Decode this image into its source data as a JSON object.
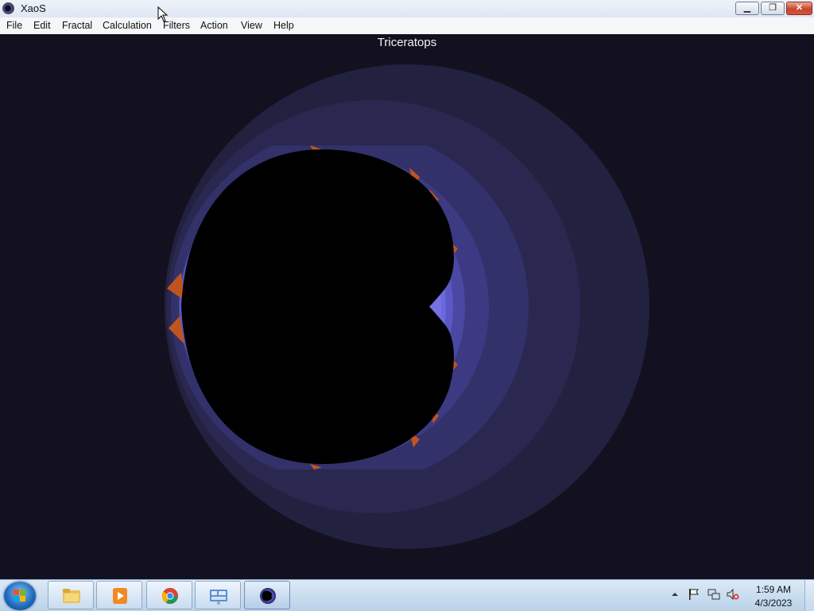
{
  "window": {
    "title": "XaoS",
    "icon": "xaos-app-icon",
    "controls": {
      "minimize": "minimize-icon",
      "maximize": "restore-icon",
      "close": "close-icon"
    }
  },
  "menu": {
    "items": [
      "File",
      "Edit",
      "Fractal",
      "Calculation",
      "Filters",
      "Action",
      "View",
      "Help"
    ]
  },
  "canvas": {
    "fractal_name": "Triceratops",
    "background_color": "#13111f",
    "palette": [
      "#25233f",
      "#2d2b55",
      "#39377a",
      "#4c4aa8",
      "#6d6bd8",
      "#000000",
      "#c25a24"
    ]
  },
  "taskbar": {
    "start_icon": "windows-start-icon",
    "pinned": [
      {
        "name": "file-explorer",
        "icon": "folder-icon"
      },
      {
        "name": "media-player",
        "icon": "media-player-icon"
      },
      {
        "name": "chrome",
        "icon": "chrome-icon"
      },
      {
        "name": "control-panel",
        "icon": "control-panel-icon"
      },
      {
        "name": "xaos",
        "icon": "xaos-icon",
        "active": true
      }
    ],
    "tray": [
      "show-hidden-icons-icon",
      "action-center-flag-icon",
      "network-icon",
      "volume-muted-icon"
    ],
    "clock": {
      "time": "1:59 AM",
      "date": "4/3/2023"
    }
  }
}
